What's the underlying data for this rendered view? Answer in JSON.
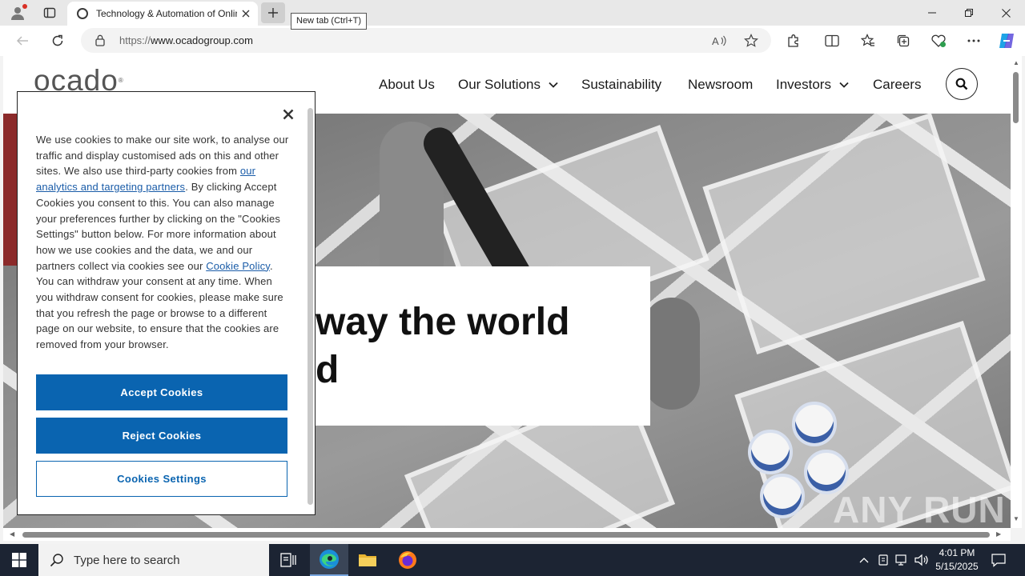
{
  "browser": {
    "tab_title": "Technology & Automation of Online Grocery",
    "new_tab_tooltip": "New tab (Ctrl+T)",
    "url_prefix": "https://",
    "url_host": "www.ocadogroup.com"
  },
  "site": {
    "logo": "ocado",
    "nav": {
      "about": "About Us",
      "solutions": "Our Solutions",
      "sustainability": "Sustainability",
      "newsroom": "Newsroom",
      "investors": "Investors",
      "careers": "Careers"
    },
    "hero": {
      "line1": "way the world",
      "line2": "d"
    },
    "watermark": "ANY RUN"
  },
  "cookie_dialog": {
    "text_1": "We use cookies to make our site work, to analyse our traffic and display customised ads on this and other sites. We also use third-party cookies from ",
    "link_partners": "our analytics and targeting partners",
    "text_2": ". By clicking Accept Cookies you consent to this. You can also manage your preferences further by clicking on the \"Cookies Settings\" button below. For more information about how we use cookies and the data, we and our partners collect via cookies see our ",
    "link_policy": "Cookie Policy",
    "text_3": ". You can withdraw your consent at any time. When you withdraw consent for cookies, please make sure that you refresh the page or browse to a different page on our website, to ensure that the cookies are removed from your browser.",
    "accept": "Accept Cookies",
    "reject": "Reject Cookies",
    "settings": "Cookies Settings"
  },
  "taskbar": {
    "search_placeholder": "Type here to search",
    "time": "4:01 PM",
    "date": "5/15/2025"
  },
  "colors": {
    "accent": "#0a64b0",
    "taskbar": "#1c2433"
  }
}
